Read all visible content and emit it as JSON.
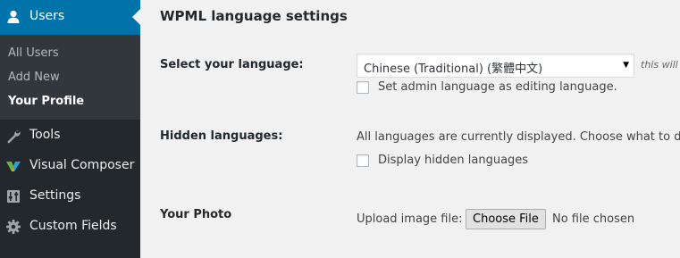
{
  "sidebar": {
    "active": {
      "label": "Users",
      "icon": "user-icon"
    },
    "submenu": [
      {
        "label": "All Users"
      },
      {
        "label": "Add New"
      },
      {
        "label": "Your Profile",
        "current": true
      }
    ],
    "items": [
      {
        "label": "Tools",
        "icon": "wrench-icon"
      },
      {
        "label": "Visual Composer",
        "icon": "visual-composer-icon"
      },
      {
        "label": "Settings",
        "icon": "settings-sliders-icon"
      },
      {
        "label": "Custom Fields",
        "icon": "gear-icon"
      }
    ]
  },
  "main": {
    "section_title": "WPML language settings",
    "language": {
      "label": "Select your language:",
      "selected": "Chinese (Traditional) (繁體中文)",
      "hint": "this will",
      "admin_checkbox_label": "Set admin language as editing language.",
      "admin_checkbox_checked": false
    },
    "hidden": {
      "label": "Hidden languages:",
      "text": "All languages are currently displayed. Choose what to do",
      "checkbox_label": "Display hidden languages",
      "checkbox_checked": false
    },
    "photo": {
      "label": "Your Photo",
      "upload_label": "Upload image file:",
      "button_label": "Choose File",
      "status": "No file chosen"
    }
  },
  "colors": {
    "sidebar_bg": "#23282d",
    "submenu_bg": "#32373c",
    "active_bg": "#0073aa",
    "page_bg": "#f1f1f1"
  }
}
